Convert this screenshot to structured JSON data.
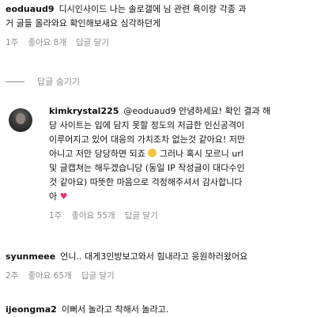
{
  "comment1": {
    "username": "eoduaud9",
    "text_line1": "디시인사이드 나는 솔로갤에 님 관련 욕이랑 각종 과",
    "text_line2": "거 글들 올라와요 확인해보새요 심각하던게",
    "time": "1주",
    "likes": "좋아요 8개",
    "reply": "답글 달기"
  },
  "hide_replies": {
    "label": "답글 숨기기"
  },
  "reply1": {
    "username": "kimkrystal225",
    "mention": "@eoduaud9",
    "text_line1_rest": "안녕하세요! 확인 결과 해",
    "text_line2": "당 사이트는 입에 담지 못할 정도의 저급한 인신공격이",
    "text_line3": "이루어지고 있어 대응의 가치조차 없는것 같아요! 저만",
    "text_line4_a": "아니고 저만 당당하면 되죠",
    "text_line4_b": "그러나 혹시 모르니 url",
    "text_line5": "및 글캡쳐는 해두겠습니당 (동일 IP 작성글이 대다수인",
    "text_line6": "것 같아요) 따뜻한 마음으로 걱정해주셔서 감사합니다",
    "text_line7": "아",
    "time": "1주",
    "likes": "좋아요 55개",
    "reply": "답글 달기",
    "avatar_icon": "profile-photo",
    "smile_icon": "grinning-face-emoji",
    "heart_icon": "pink-heart-emoji",
    "heart_color": "#e8336d"
  },
  "comment2": {
    "username": "syunmeee",
    "text": "언니.. 대게3인방보고와서 힘내라고 응원하러왔어요",
    "time": "2주",
    "likes": "좋아요 65개",
    "reply": "답글 달기"
  },
  "comment3": {
    "username": "ijeongma2",
    "text": "이뻐서 놀라고 착해서 놀라고."
  },
  "colors": {
    "text": "#111111",
    "meta": "#8e8e8e",
    "background": "#ffffff"
  }
}
